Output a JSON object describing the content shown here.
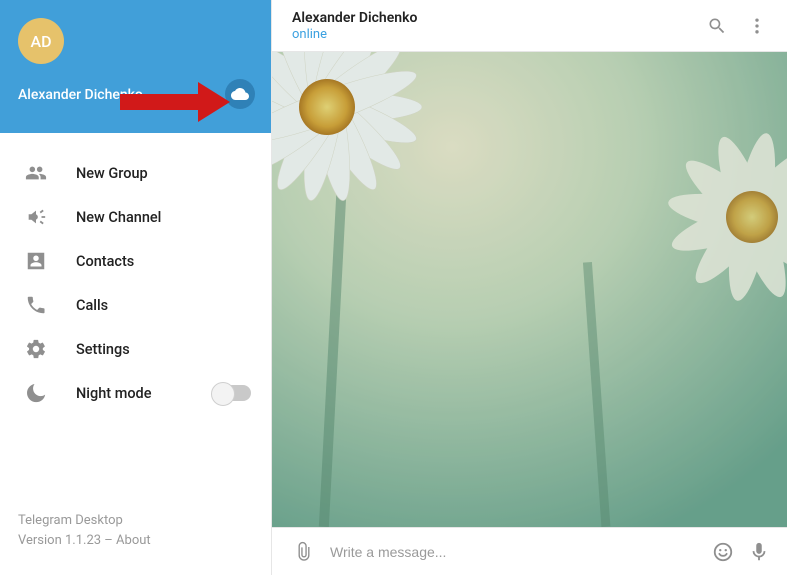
{
  "sidebar": {
    "avatar_initials": "AD",
    "username": "Alexander Dichenko",
    "menu": [
      {
        "label": "New Group"
      },
      {
        "label": "New Channel"
      },
      {
        "label": "Contacts"
      },
      {
        "label": "Calls"
      },
      {
        "label": "Settings"
      },
      {
        "label": "Night mode"
      }
    ],
    "footer": {
      "app": "Telegram Desktop",
      "version_line": "Version 1.1.23 – ",
      "about": "About"
    }
  },
  "chat": {
    "title": "Alexander Dichenko",
    "status": "online"
  },
  "composer": {
    "placeholder": "Write a message..."
  }
}
